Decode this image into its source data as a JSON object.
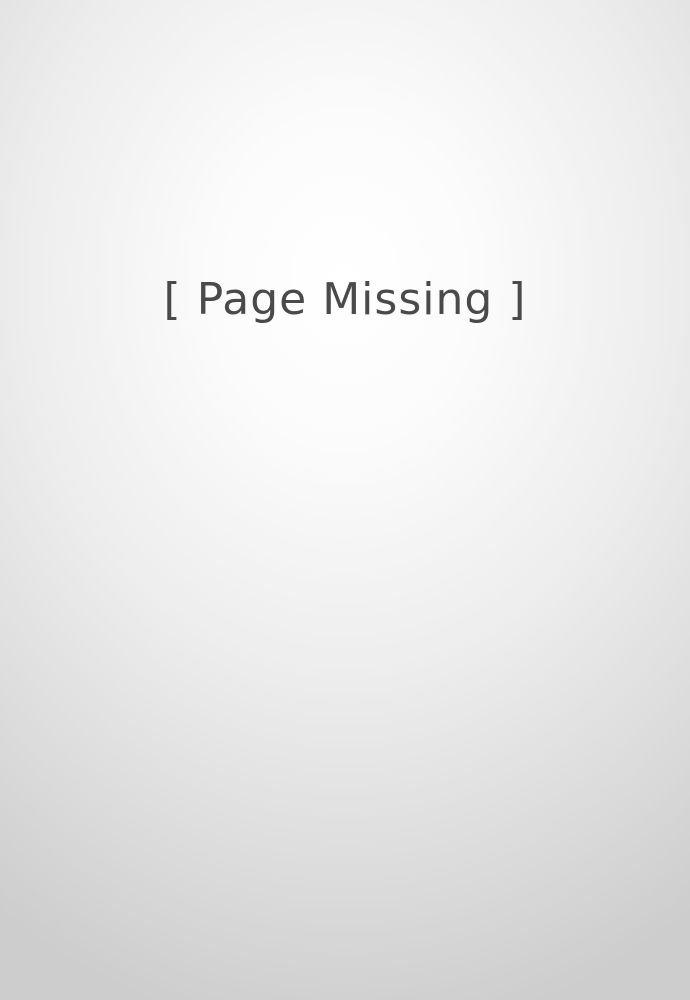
{
  "page": {
    "message": "[ Page Missing ]",
    "text_color": "#4a4a4a",
    "background_center_color": "#ffffff",
    "background_edge_color": "#cdcdcd"
  }
}
